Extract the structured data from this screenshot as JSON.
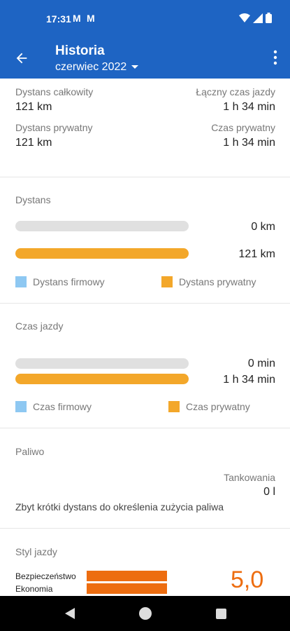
{
  "status": {
    "time": "17:31",
    "notif1": "M",
    "notif2": "M"
  },
  "header": {
    "title": "Historia",
    "period": "czerwiec 2022"
  },
  "summary": {
    "total_distance_label": "Dystans całkowity",
    "total_distance_value": "121 km",
    "total_time_label": "Łączny czas jazdy",
    "total_time_value": "1 h 34 min",
    "private_distance_label": "Dystans prywatny",
    "private_distance_value": "121 km",
    "private_time_label": "Czas prywatny",
    "private_time_value": "1 h 34 min"
  },
  "distance": {
    "title": "Dystans",
    "business_value": "0 km",
    "private_value": "121 km",
    "business_fraction": 1.0,
    "private_fraction": 1.0,
    "legend_business": "Dystans firmowy",
    "legend_private": "Dystans prywatny"
  },
  "drive_time": {
    "title": "Czas jazdy",
    "business_value": "0 min",
    "private_value": "1 h 34 min",
    "legend_business": "Czas firmowy",
    "legend_private": "Czas prywatny"
  },
  "fuel": {
    "title": "Paliwo",
    "refuels_label": "Tankowania",
    "refuels_value": "0 l",
    "note": "Zbyt krótki dystans do określenia zużycia paliwa"
  },
  "driving_style": {
    "title": "Styl jazdy",
    "safety_label": "Bezpieczeństwo",
    "economy_label": "Ekonomia",
    "score": "5,0"
  },
  "colors": {
    "primary": "#1e64c3",
    "orange": "#f3a72a",
    "blue_legend": "#8ec8f2",
    "style_orange": "#ed6d10"
  }
}
